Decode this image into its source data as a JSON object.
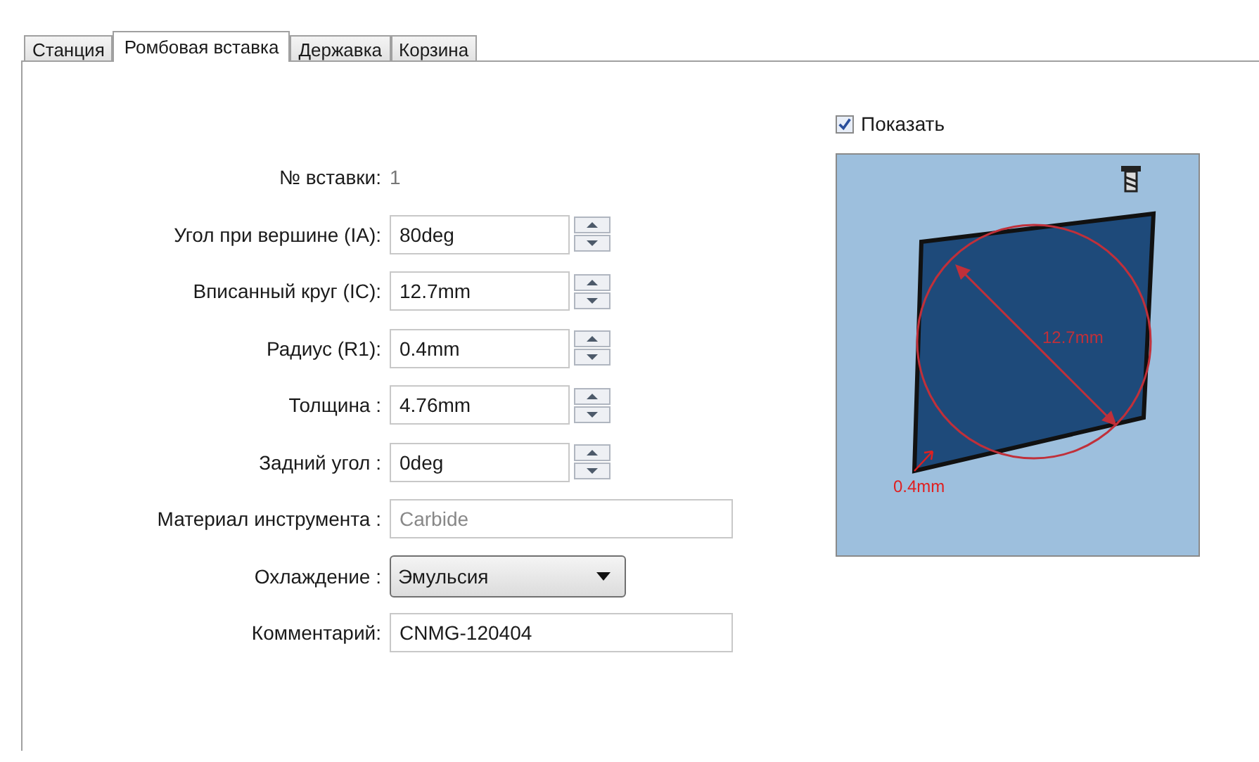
{
  "tabs": [
    {
      "label": "Станция",
      "selected": false
    },
    {
      "label": "Ромбовая вставка",
      "selected": true
    },
    {
      "label": "Державка",
      "selected": false
    },
    {
      "label": "Корзина",
      "selected": false
    }
  ],
  "fields": [
    {
      "kind": "static",
      "label": "№ вставки:",
      "value": "1"
    },
    {
      "kind": "spin",
      "label": "Угол при вершине (IA):",
      "value": "80deg"
    },
    {
      "kind": "spin",
      "label": "Вписанный круг (IC):",
      "value": "12.7mm"
    },
    {
      "kind": "spin",
      "label": "Радиус (R1):",
      "value": "0.4mm"
    },
    {
      "kind": "spin",
      "label": "Толщина :",
      "value": "4.76mm"
    },
    {
      "kind": "spin",
      "label": "Задний угол :",
      "value": "0deg"
    },
    {
      "kind": "text",
      "label": "Материал инструмента :",
      "value": "Carbide",
      "disabled": true
    },
    {
      "kind": "dropdown",
      "label": "Охлаждение :",
      "value": "Эмульсия"
    },
    {
      "kind": "text",
      "label": "Комментарий:",
      "value": "CNMG-120404",
      "disabled": false
    }
  ],
  "preview": {
    "show": {
      "label": "Показать",
      "checked": true
    },
    "diameter_label": "12.7mm",
    "corner_label": "0.4mm"
  }
}
